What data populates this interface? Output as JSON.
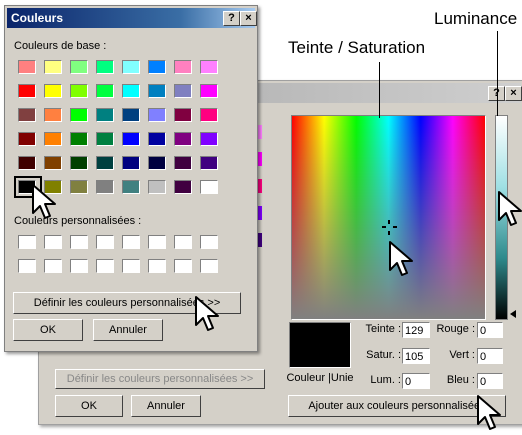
{
  "annotations": {
    "luminance": "Luminance",
    "hue_sat": "Teinte / Saturation"
  },
  "back_dialog": {
    "help_button": "?",
    "close_button": "×",
    "define_custom_button": "Définir les couleurs personnalisées >>",
    "ok_button": "OK",
    "cancel_button": "Annuler",
    "preview_label": "Couleur |Unie",
    "hue_label": "Teinte :",
    "hue_value": "129",
    "sat_label": "Satur. :",
    "sat_value": "105",
    "lum_label": "Lum. :",
    "lum_value": "0",
    "red_label": "Rouge :",
    "red_value": "0",
    "green_label": "Vert :",
    "green_value": "0",
    "blue_label": "Bleu :",
    "blue_value": "0",
    "add_custom_button": "Ajouter aux couleurs personnalisées"
  },
  "front_dialog": {
    "title": "Couleurs",
    "help_button": "?",
    "close_button": "×",
    "basic_colors_label": "Couleurs de base :",
    "custom_colors_label": "Couleurs personnalisées :",
    "define_custom_button": "Définir les couleurs personnalisées >>",
    "ok_button": "OK",
    "cancel_button": "Annuler",
    "basic_colors": [
      [
        "#ff8080",
        "#ffff80",
        "#80ff80",
        "#00ff80",
        "#80ffff",
        "#0080ff",
        "#ff80c0",
        "#ff80ff"
      ],
      [
        "#ff0000",
        "#ffff00",
        "#80ff00",
        "#00ff40",
        "#00ffff",
        "#0080c0",
        "#8080c0",
        "#ff00ff"
      ],
      [
        "#804040",
        "#ff8040",
        "#00ff00",
        "#008080",
        "#004080",
        "#8080ff",
        "#800040",
        "#ff0080"
      ],
      [
        "#800000",
        "#ff8000",
        "#008000",
        "#008040",
        "#0000ff",
        "#0000a0",
        "#800080",
        "#8000ff"
      ],
      [
        "#400000",
        "#804000",
        "#004000",
        "#004040",
        "#000080",
        "#000040",
        "#400040",
        "#400080"
      ],
      [
        "#000000",
        "#808000",
        "#808040",
        "#808080",
        "#408080",
        "#c0c0c0",
        "#400040",
        "#ffffff"
      ]
    ]
  }
}
